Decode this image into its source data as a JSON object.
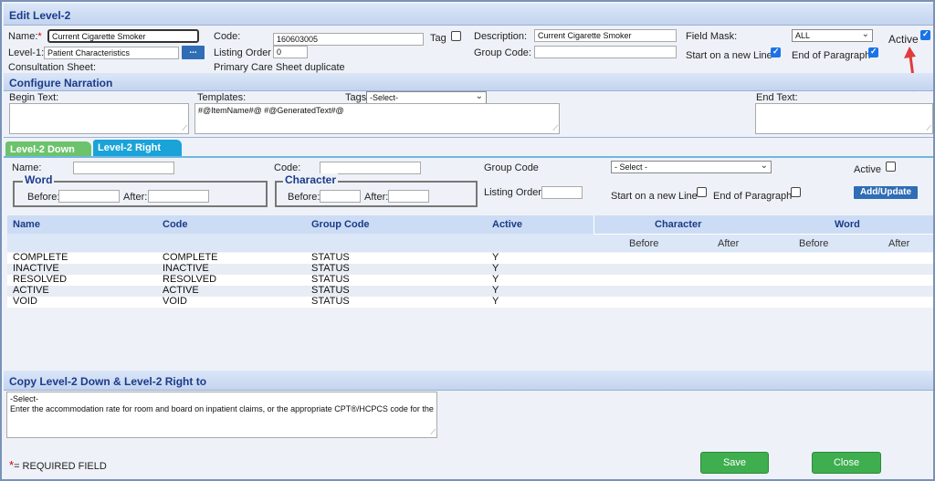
{
  "edit": {
    "title": "Edit Level-2",
    "name_label": "Name:",
    "required_mark": "*",
    "name_value": "Current Cigarette Smoker",
    "level1_label": "Level-1:",
    "level1_value": "Patient Characteristics",
    "level1_button": "...",
    "consultation_label": "Consultation Sheet:",
    "code_label": "Code:",
    "code_value": "160603005",
    "listing_order_label": "Listing Order",
    "listing_order_value": "0",
    "consultation_value": "Primary Care Sheet duplicate",
    "tag_label": "Tag",
    "description_label": "Description:",
    "description_value": "Current Cigarette Smoker",
    "group_code_label": "Group Code:",
    "group_code_value": "",
    "field_mask_label": "Field Mask:",
    "field_mask_value": "ALL",
    "start_new_line_label": "Start on a new Line",
    "end_paragraph_label": "End of Paragraph",
    "active_label": "Active"
  },
  "narration": {
    "title": "Configure Narration",
    "begin_text_label": "Begin Text:",
    "templates_label": "Templates:",
    "tags_label": "Tags",
    "tags_value": "-Select-",
    "templates_value": "#@ItemName#@ #@GeneratedText#@",
    "end_text_label": "End Text:"
  },
  "tabs": [
    {
      "label": "Level-2 Down",
      "color": "#6cc36c"
    },
    {
      "label": "Level-2 Right",
      "color": "#1aa3d9"
    }
  ],
  "right_form": {
    "name_label": "Name:",
    "code_label": "Code:",
    "group_code_label": "Group Code",
    "group_code_value": "- Select -",
    "active_label": "Active",
    "word_legend": "Word",
    "character_legend": "Character",
    "before_label": "Before:",
    "after_label": "After:",
    "listing_order_label": "Listing Order:",
    "start_new_line_label": "Start on a new Line",
    "end_paragraph_label": "End of Paragraph",
    "add_update_button": "Add/Update"
  },
  "grid": {
    "headers": {
      "name": "Name",
      "code": "Code",
      "group_code": "Group Code",
      "active": "Active",
      "character": "Character",
      "word": "Word"
    },
    "subheaders": {
      "char_before": "Before",
      "char_after": "After",
      "word_before": "Before",
      "word_after": "After"
    },
    "rows": [
      {
        "name": "COMPLETE",
        "code": "COMPLETE",
        "group": "STATUS",
        "active": "Y"
      },
      {
        "name": "INACTIVE",
        "code": "INACTIVE",
        "group": "STATUS",
        "active": "Y"
      },
      {
        "name": "RESOLVED",
        "code": "RESOLVED",
        "group": "STATUS",
        "active": "Y"
      },
      {
        "name": "ACTIVE",
        "code": "ACTIVE",
        "group": "STATUS",
        "active": "Y"
      },
      {
        "name": "VOID",
        "code": "VOID",
        "group": "STATUS",
        "active": "Y"
      }
    ]
  },
  "copy": {
    "title": "Copy Level-2 Down & Level-2 Right to",
    "option_select": "-Select-",
    "option_text": "Enter the accommodation rate for room and board on inpatient claims, or the appropriate CPT®/HCPCS code for the out"
  },
  "footer": {
    "required_mark": "*",
    "required_text": "= REQUIRED FIELD",
    "save_label": "Save",
    "close_label": "Close"
  },
  "colors": {
    "accent_blue": "#1b3b8a",
    "button_green": "#3fae4f",
    "annotation_red": "#e23b3b"
  }
}
